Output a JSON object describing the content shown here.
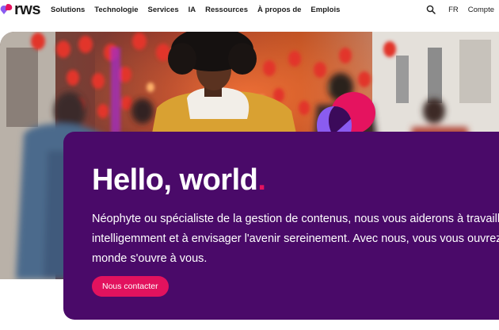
{
  "brand": {
    "name": "rws"
  },
  "nav": {
    "items": [
      "Solutions",
      "Technologie",
      "Services",
      "IA",
      "Ressources",
      "À propos de",
      "Emplois"
    ],
    "language": "FR",
    "account": "Compte"
  },
  "hero": {
    "headline": "Hello, world",
    "headline_dot": ".",
    "description_lines": [
      "Néophyte ou spécialiste de la gestion de contenus, nous vous aiderons à travailler",
      "intelligemment et à envisager l'avenir sereinement. Avec nous, vous vous ouvrez",
      "monde s'ouvre à vous."
    ],
    "cta_label": "Nous contacter"
  },
  "colors": {
    "card_bg": "#4a0a69",
    "accent_pink": "#e5135f",
    "accent_lilac": "#8a5cf0"
  },
  "icons": {
    "search": "search-icon",
    "logo": "rws-logo-mark"
  }
}
